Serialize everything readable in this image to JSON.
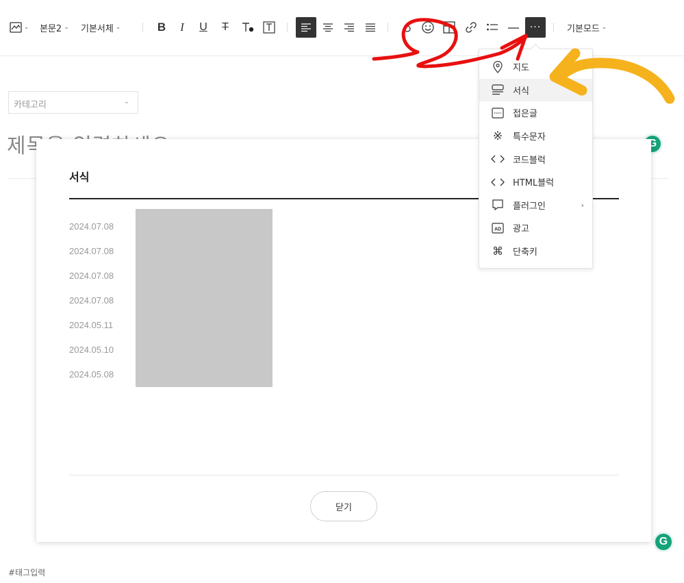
{
  "toolbar": {
    "paragraph_style": "본문2",
    "font_family": "기본서체",
    "mode": "기본모드",
    "more_label": "···"
  },
  "editor": {
    "category_placeholder": "카테고리",
    "title_placeholder": "제목을 입력하세요",
    "tag_placeholder": "#태그입력"
  },
  "modal": {
    "title": "서식",
    "dates": [
      "2024.07.08",
      "2024.07.08",
      "2024.07.08",
      "2024.07.08",
      "2024.05.11",
      "2024.05.10",
      "2024.05.08"
    ],
    "close_label": "닫기"
  },
  "menu": {
    "items": [
      {
        "label": "지도",
        "icon": "map-pin-icon"
      },
      {
        "label": "서식",
        "icon": "template-icon"
      },
      {
        "label": "접은글",
        "icon": "fold-icon"
      },
      {
        "label": "특수문자",
        "icon": "special-char-icon"
      },
      {
        "label": "코드블럭",
        "icon": "code-icon"
      },
      {
        "label": "HTML블럭",
        "icon": "html-icon"
      },
      {
        "label": "플러그인",
        "icon": "plugin-icon"
      },
      {
        "label": "광고",
        "icon": "ad-icon"
      },
      {
        "label": "단축키",
        "icon": "command-icon"
      }
    ],
    "active_item": "서식"
  },
  "colors": {
    "annotation_red": "#e8100f",
    "annotation_yellow": "#f5b21c",
    "grammarly_green": "#15a37a",
    "dark_button": "#333333"
  }
}
